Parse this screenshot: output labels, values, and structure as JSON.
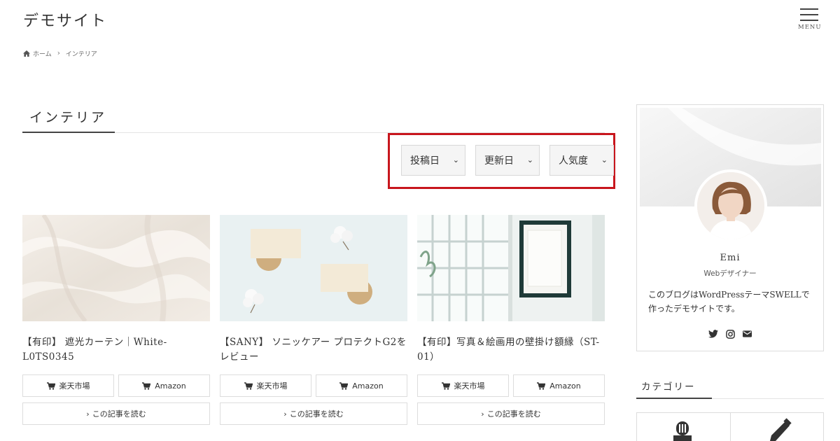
{
  "header": {
    "site_title": "デモサイト",
    "menu_label": "MENU"
  },
  "breadcrumb": {
    "home": "ホーム",
    "current": "インテリア"
  },
  "page": {
    "title": "インテリア"
  },
  "sort": {
    "options": [
      "投稿日",
      "更新日",
      "人気度"
    ],
    "highlight_color": "#c8161d"
  },
  "posts": [
    {
      "title": "【有印】 遮光カーテン｜White-L0TS0345",
      "rakuten": "楽天市場",
      "amazon": "Amazon",
      "read": "この記事を読む"
    },
    {
      "title": "【SANY】 ソニッケアー プロテクトG2をレビュー",
      "rakuten": "楽天市場",
      "amazon": "Amazon",
      "read": "この記事を読む"
    },
    {
      "title": "【有印】写真＆絵画用の壁掛け額縁（ST-01）",
      "rakuten": "楽天市場",
      "amazon": "Amazon",
      "read": "この記事を読む"
    }
  ],
  "profile": {
    "name": "Emi",
    "role": "Webデザイナー",
    "bio": "このブログはWordPressテーマSWELLで作ったデモサイトです。",
    "socials": [
      "twitter-icon",
      "instagram-icon",
      "mail-icon"
    ]
  },
  "sidebar": {
    "category_title": "カテゴリー"
  }
}
